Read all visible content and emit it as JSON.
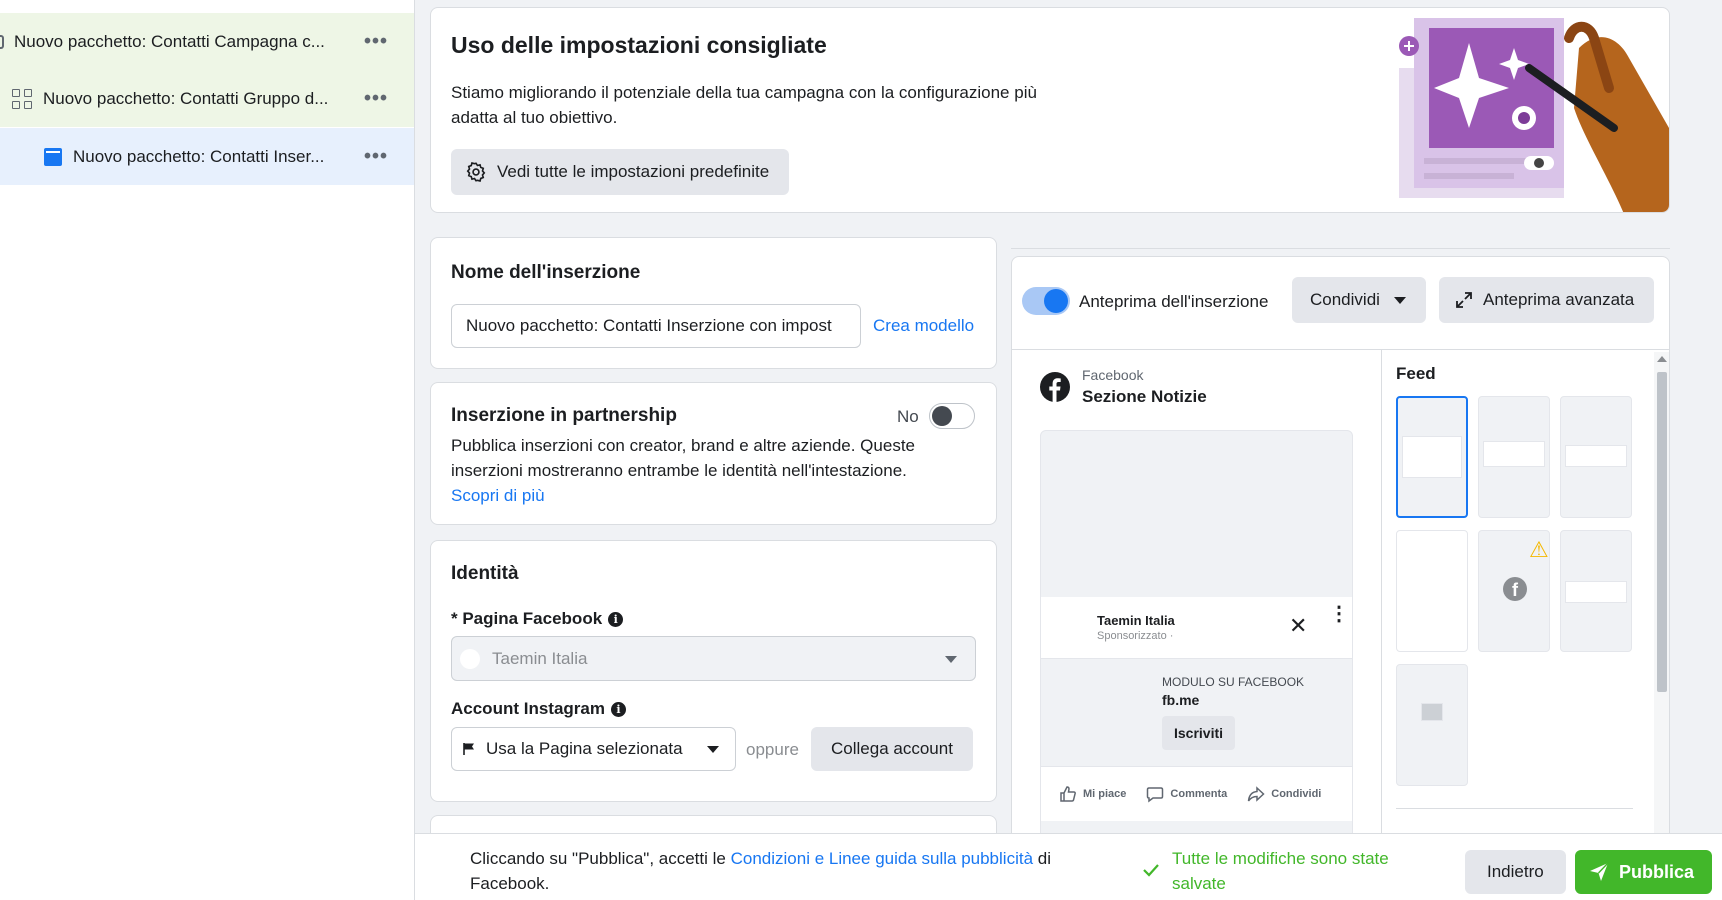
{
  "sidebar": {
    "items": [
      {
        "label": "Nuovo pacchetto: Contatti Campagna c...",
        "icon": "campaign-bracket-icon"
      },
      {
        "label": "Nuovo pacchetto: Contatti Gruppo d...",
        "icon": "grid-icon"
      },
      {
        "label": "Nuovo pacchetto: Contatti Inser...",
        "icon": "ad-icon"
      }
    ],
    "more_glyph": "•••"
  },
  "recommended": {
    "title": "Uso delle impostazioni consigliate",
    "description": "Stiamo migliorando il potenziale della tua campagna con la configurazione più adatta al tuo obiettivo.",
    "button_label": "Vedi tutte le impostazioni predefinite"
  },
  "ad_name": {
    "title": "Nome dell'inserzione",
    "value": "Nuovo pacchetto: Contatti Inserzione con impost",
    "template_link": "Crea modello"
  },
  "partnership": {
    "title": "Inserzione in partnership",
    "toggle_label": "No",
    "description": "Pubblica inserzioni con creator, brand e altre aziende. Queste inserzioni mostreranno entrambe le identità nell'intestazione.",
    "learn_more": "Scopri di più"
  },
  "identity": {
    "title": "Identità",
    "fb_page_label": "* Pagina Facebook",
    "fb_page_value": "Taemin Italia",
    "ig_label": "Account Instagram",
    "ig_value": "Usa la Pagina selezionata",
    "or_text": "oppure",
    "connect_button": "Collega account",
    "info_glyph": "i"
  },
  "preview": {
    "toggle_label": "Anteprima dell'inserzione",
    "share_button": "Condividi",
    "advanced_button": "Anteprima avanzata",
    "platform": "Facebook",
    "placement": "Sezione Notizie",
    "mock": {
      "page_name": "Taemin Italia",
      "sponsored": "Sponsorizzato · ",
      "form_label": "MODULO SU FACEBOOK",
      "domain": "fb.me",
      "cta": "Iscriviti",
      "close_glyph": "✕",
      "menu_glyph": "⋮",
      "actions": [
        "Mi piace",
        "Commenta",
        "Condividi"
      ]
    },
    "feed_title": "Feed",
    "warn_glyph": "⚠",
    "fb_glyph": "f"
  },
  "bottom": {
    "terms_prefix": "Cliccando su \"Pubblica\", accetti le ",
    "terms_link": "Condizioni e Linee guida sulla pubblicità",
    "terms_suffix": " di Facebook.",
    "saved_text": "Tutte le modifiche sono state salvate",
    "back_button": "Indietro",
    "publish_button": "Pubblica"
  },
  "colors": {
    "accent": "#1877f2",
    "publish": "#42b72a",
    "campaign_row": "#eef6e6",
    "selected_row": "#e7f0fd"
  }
}
